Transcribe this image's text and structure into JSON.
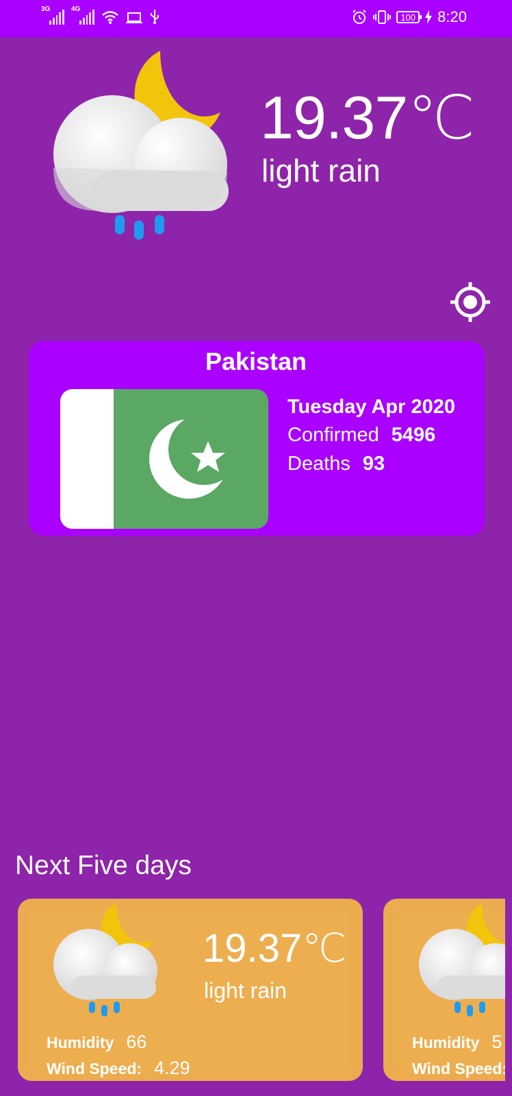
{
  "status_bar": {
    "sim1_tag": "3G",
    "sim2_tag": "4G",
    "battery": "100",
    "time": "8:20"
  },
  "current": {
    "temperature": "19.37℃",
    "description": "light rain",
    "icon": "cloud-moon-rain-icon"
  },
  "country": {
    "name": "Pakistan",
    "date": "Tuesday Apr 2020",
    "confirmed_label": "Confirmed",
    "confirmed_value": "5496",
    "deaths_label": "Deaths",
    "deaths_value": "93",
    "flag_colors": {
      "green": "#5aa863",
      "white": "#ffffff"
    }
  },
  "forecast": {
    "title": "Next Five days",
    "cards": [
      {
        "temperature": "19.37℃",
        "description": "light rain",
        "humidity_label": "Humidity",
        "humidity_value": "66",
        "wind_label": "Wind Speed:",
        "wind_value": "4.29"
      },
      {
        "temperature": "",
        "description": "",
        "humidity_label": "Humidity",
        "humidity_value": "5",
        "wind_label": "Wind Speed:",
        "wind_value": ""
      }
    ]
  },
  "colors": {
    "background": "#8e24aa",
    "status_bar": "#aa00ff",
    "card": "#aa00ff",
    "forecast_card": "#ecab4e",
    "moon": "#f2c40c",
    "rain": "#1e9bf0"
  }
}
